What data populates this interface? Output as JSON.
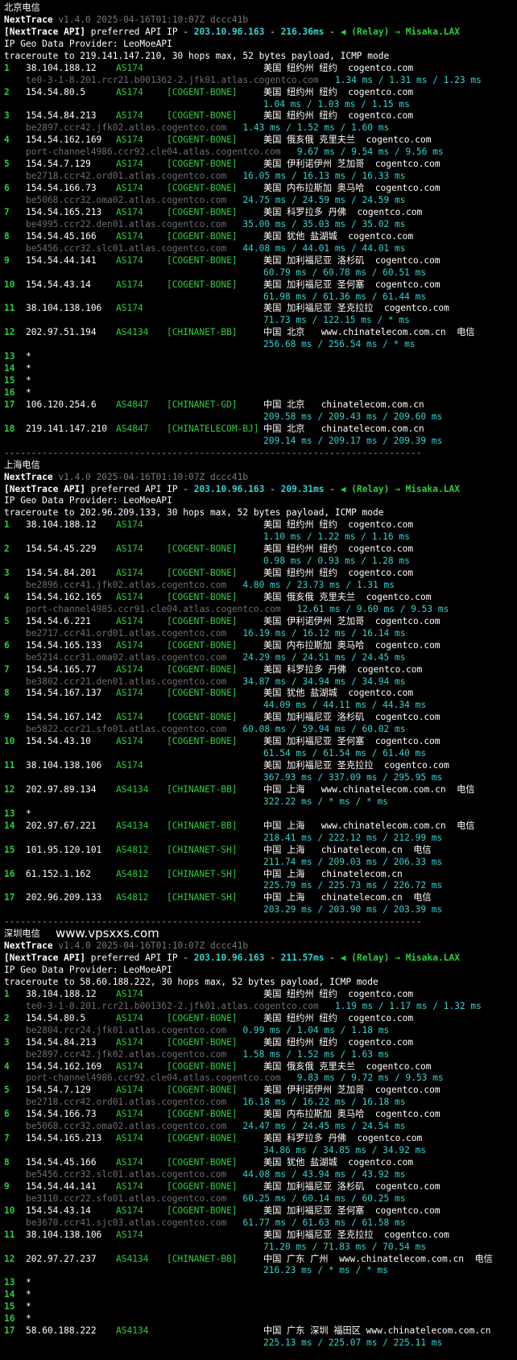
{
  "colors": {
    "background": "#000000",
    "asn": "#2ecc40",
    "rtt": "#3ad0d0",
    "hostname": "#6e6e6e"
  },
  "sections": [
    {
      "title": "北京电信",
      "version_name": "NextTrace",
      "version": "v1.4.0 2025-04-16T01:10:07Z dccc41b",
      "api_prefix": "[NextTrace API]",
      "api_text": "preferred API IP -",
      "api_ip": "203.10.96.163",
      "api_dash": "-",
      "api_latency": "216.36ms",
      "api_dash2": "-",
      "api_relay": "◀ (Relay) → Misaka.LAX",
      "geo_provider": "IP Geo Data Provider: LeoMoeAPI",
      "traceroute": "traceroute to 219.141.147.210, 30 hops max, 52 bytes payload, ICMP mode",
      "hops": [
        {
          "n": "1",
          "ip": "38.104.188.12",
          "asn": "AS174",
          "tag": "",
          "geo": "美国 纽约州 纽约  cogentco.com",
          "host": "te0-3-1-8.201.rcr21.b001362-2.jfk01.atlas.cogentco.com",
          "rtt": "1.34 ms / 1.31 ms / 1.23 ms"
        },
        {
          "n": "2",
          "ip": "154.54.80.5",
          "asn": "AS174",
          "tag": "[COGENT-BONE]",
          "geo": "美国 纽约州 纽约  cogentco.com",
          "host": "",
          "rtt": "1.04 ms / 1.03 ms / 1.15 ms"
        },
        {
          "n": "3",
          "ip": "154.54.84.213",
          "asn": "AS174",
          "tag": "[COGENT-BONE]",
          "geo": "美国 纽约州 纽约  cogentco.com",
          "host": "be2897.ccr42.jfk02.atlas.cogentco.com",
          "rtt": "1.43 ms / 1.52 ms / 1.60 ms"
        },
        {
          "n": "4",
          "ip": "154.54.162.169",
          "asn": "AS174",
          "tag": "[COGENT-BONE]",
          "geo": "美国 俄亥俄 克里夫兰  cogentco.com",
          "host": "port-channel4986.ccr92.cle04.atlas.cogentco.com",
          "rtt": "9.67 ms / 9.54 ms / 9.56 ms"
        },
        {
          "n": "5",
          "ip": "154.54.7.129",
          "asn": "AS174",
          "tag": "[COGENT-BONE]",
          "geo": "美国 伊利诺伊州 芝加哥  cogentco.com",
          "host": "be2718.ccr42.ord01.atlas.cogentco.com",
          "rtt": "16.05 ms / 16.13 ms / 16.33 ms"
        },
        {
          "n": "6",
          "ip": "154.54.166.73",
          "asn": "AS174",
          "tag": "[COGENT-BONE]",
          "geo": "美国 内布拉斯加 奥马哈  cogentco.com",
          "host": "be5068.ccr32.oma02.atlas.cogentco.com",
          "rtt": "24.75 ms / 24.59 ms / 24.59 ms"
        },
        {
          "n": "7",
          "ip": "154.54.165.213",
          "asn": "AS174",
          "tag": "[COGENT-BONE]",
          "geo": "美国 科罗拉多 丹佛  cogentco.com",
          "host": "be4995.ccr22.den01.atlas.cogentco.com",
          "rtt": "35.00 ms / 35.03 ms / 35.02 ms"
        },
        {
          "n": "8",
          "ip": "154.54.45.166",
          "asn": "AS174",
          "tag": "[COGENT-BONE]",
          "geo": "美国 犹他 盐湖城  cogentco.com",
          "host": "be5456.ccr32.slc01.atlas.cogentco.com",
          "rtt": "44.08 ms / 44.01 ms / 44.01 ms"
        },
        {
          "n": "9",
          "ip": "154.54.44.141",
          "asn": "AS174",
          "tag": "[COGENT-BONE]",
          "geo": "美国 加利福尼亚 洛杉矶  cogentco.com",
          "host": "",
          "rtt": "60.79 ms / 60.78 ms / 60.51 ms"
        },
        {
          "n": "10",
          "ip": "154.54.43.14",
          "asn": "AS174",
          "tag": "[COGENT-BONE]",
          "geo": "美国 加利福尼亚 圣何塞  cogentco.com",
          "host": "",
          "rtt": "61.98 ms / 61.36 ms / 61.44 ms"
        },
        {
          "n": "11",
          "ip": "38.104.138.106",
          "asn": "AS174",
          "tag": "",
          "geo": "美国 加利福尼亚 圣克拉拉  cogentco.com",
          "host": "",
          "rtt": "71.73 ms / 122.15 ms / * ms"
        },
        {
          "n": "12",
          "ip": "202.97.51.194",
          "asn": "AS4134",
          "tag": "[CHINANET-BB]",
          "geo": "中国 北京   www.chinatelecom.com.cn  电信",
          "host": "",
          "rtt": "256.68 ms / 256.54 ms / * ms"
        },
        {
          "n": "13",
          "ip": "*",
          "asn": "",
          "tag": "",
          "geo": "",
          "host": "",
          "rtt": "",
          "star": true
        },
        {
          "n": "14",
          "ip": "*",
          "asn": "",
          "tag": "",
          "geo": "",
          "host": "",
          "rtt": "",
          "star": true
        },
        {
          "n": "15",
          "ip": "*",
          "asn": "",
          "tag": "",
          "geo": "",
          "host": "",
          "rtt": "",
          "star": true
        },
        {
          "n": "16",
          "ip": "*",
          "asn": "",
          "tag": "",
          "geo": "",
          "host": "",
          "rtt": "",
          "star": true
        },
        {
          "n": "17",
          "ip": "106.120.254.6",
          "asn": "AS4847",
          "tag": "[CHINANET-GD]",
          "geo": "中国 北京   chinatelecom.com.cn",
          "host": "",
          "rtt": "209.58 ms / 209.43 ms / 209.60 ms"
        },
        {
          "n": "18",
          "ip": "219.141.147.210",
          "asn": "AS4847",
          "tag": "[CHINATELECOM-BJ]",
          "geo": "中国 北京   chinatelecom.com.cn",
          "host": "",
          "rtt": "209.14 ms / 209.17 ms / 209.39 ms"
        }
      ]
    },
    {
      "title": "上海电信",
      "version_name": "NextTrace",
      "version": "v1.4.0 2025-04-16T01:10:07Z dccc41b",
      "api_prefix": "[NextTrace API]",
      "api_text": "preferred API IP -",
      "api_ip": "203.10.96.163",
      "api_dash": "-",
      "api_latency": "209.31ms",
      "api_dash2": "-",
      "api_relay": "◀ (Relay) → Misaka.LAX",
      "geo_provider": "IP Geo Data Provider: LeoMoeAPI",
      "traceroute": "traceroute to 202.96.209.133, 30 hops max, 52 bytes payload, ICMP mode",
      "hops": [
        {
          "n": "1",
          "ip": "38.104.188.12",
          "asn": "AS174",
          "tag": "",
          "geo": "美国 纽约州 纽约  cogentco.com",
          "host": "",
          "rtt": "1.10 ms / 1.22 ms / 1.16 ms"
        },
        {
          "n": "2",
          "ip": "154.54.45.229",
          "asn": "AS174",
          "tag": "[COGENT-BONE]",
          "geo": "美国 纽约州 纽约  cogentco.com",
          "host": "",
          "rtt": "0.98 ms / 0.93 ms / 1.28 ms"
        },
        {
          "n": "3",
          "ip": "154.54.84.201",
          "asn": "AS174",
          "tag": "[COGENT-BONE]",
          "geo": "美国 纽约州 纽约  cogentco.com",
          "host": "be2896.ccr41.jfk02.atlas.cogentco.com",
          "rtt": "4.80 ms / 23.73 ms / 1.31 ms"
        },
        {
          "n": "4",
          "ip": "154.54.162.165",
          "asn": "AS174",
          "tag": "[COGENT-BONE]",
          "geo": "美国 俄亥俄 克里夫兰  cogentco.com",
          "host": "port-channel4985.ccr91.cle04.atlas.cogentco.com",
          "rtt": "12.61 ms / 9.60 ms / 9.53 ms"
        },
        {
          "n": "5",
          "ip": "154.54.6.221",
          "asn": "AS174",
          "tag": "[COGENT-BONE]",
          "geo": "美国 伊利诺伊州 芝加哥  cogentco.com",
          "host": "be2717.ccr41.ord01.atlas.cogentco.com",
          "rtt": "16.19 ms / 16.12 ms / 16.14 ms"
        },
        {
          "n": "6",
          "ip": "154.54.165.133",
          "asn": "AS174",
          "tag": "[COGENT-BONE]",
          "geo": "美国 内布拉斯加 奥马哈  cogentco.com",
          "host": "be5214.ccr31.oma02.atlas.cogentco.com",
          "rtt": "24.29 ms / 24.51 ms / 24.45 ms"
        },
        {
          "n": "7",
          "ip": "154.54.165.77",
          "asn": "AS174",
          "tag": "[COGENT-BONE]",
          "geo": "美国 科罗拉多 丹佛  cogentco.com",
          "host": "be3802.ccr21.den01.atlas.cogentco.com",
          "rtt": "34.87 ms / 34.94 ms / 34.94 ms"
        },
        {
          "n": "8",
          "ip": "154.54.167.137",
          "asn": "AS174",
          "tag": "[COGENT-BONE]",
          "geo": "美国 犹他 盐湖城  cogentco.com",
          "host": "",
          "rtt": "44.09 ms / 44.11 ms / 44.34 ms"
        },
        {
          "n": "9",
          "ip": "154.54.167.142",
          "asn": "AS174",
          "tag": "[COGENT-BONE]",
          "geo": "美国 加利福尼亚 洛杉矶  cogentco.com",
          "host": "be5822.ccr21.sfo01.atlas.cogentco.com",
          "rtt": "60.08 ms / 59.94 ms / 60.02 ms"
        },
        {
          "n": "10",
          "ip": "154.54.43.10",
          "asn": "AS174",
          "tag": "[COGENT-BONE]",
          "geo": "美国 加利福尼亚 圣何塞  cogentco.com",
          "host": "",
          "rtt": "61.54 ms / 61.54 ms / 61.40 ms"
        },
        {
          "n": "11",
          "ip": "38.104.138.106",
          "asn": "AS174",
          "tag": "",
          "geo": "美国 加利福尼亚 圣克拉拉  cogentco.com",
          "host": "",
          "rtt": "367.93 ms / 337.09 ms / 295.95 ms"
        },
        {
          "n": "12",
          "ip": "202.97.89.134",
          "asn": "AS4134",
          "tag": "[CHINANET-BB]",
          "geo": "中国 上海   www.chinatelecom.com.cn  电信",
          "host": "",
          "rtt": "322.22 ms / * ms / * ms"
        },
        {
          "n": "13",
          "ip": "*",
          "asn": "",
          "tag": "",
          "geo": "",
          "host": "",
          "rtt": "",
          "star": true
        },
        {
          "n": "14",
          "ip": "202.97.67.221",
          "asn": "AS4134",
          "tag": "[CHINANET-BB]",
          "geo": "中国 上海   www.chinatelecom.com.cn  电信",
          "host": "",
          "rtt": "218.41 ms / 222.12 ms / 212.99 ms"
        },
        {
          "n": "15",
          "ip": "101.95.120.101",
          "asn": "AS4812",
          "tag": "[CHINANET-SH]",
          "geo": "中国 上海   chinatelecom.cn  电信",
          "host": "",
          "rtt": "211.74 ms / 209.03 ms / 206.33 ms"
        },
        {
          "n": "16",
          "ip": "61.152.1.162",
          "asn": "AS4812",
          "tag": "[CHINANET-SH]",
          "geo": "中国 上海   chinatelecom.cn",
          "host": "",
          "rtt": "225.79 ms / 225.73 ms / 226.72 ms"
        },
        {
          "n": "17",
          "ip": "202.96.209.133",
          "asn": "AS4812",
          "tag": "[CHINANET-SH]",
          "geo": "中国 上海   chinatelecom.cn  电信",
          "host": "",
          "rtt": "203.29 ms / 203.90 ms / 203.39 ms"
        }
      ]
    },
    {
      "title": "深圳电信",
      "site": "www.vpsxxs.com",
      "version_name": "NextTrace",
      "version": "v1.4.0 2025-04-16T01:10:07Z dccc41b",
      "api_prefix": "[NextTrace API]",
      "api_text": "preferred API IP -",
      "api_ip": "203.10.96.163",
      "api_dash": "-",
      "api_latency": "211.57ms",
      "api_dash2": "-",
      "api_relay": "◀ (Relay) → Misaka.LAX",
      "geo_provider": "IP Geo Data Provider: LeoMoeAPI",
      "traceroute": "traceroute to 58.60.188.222, 30 hops max, 52 bytes payload, ICMP mode",
      "hops": [
        {
          "n": "1",
          "ip": "38.104.188.12",
          "asn": "AS174",
          "tag": "",
          "geo": "美国 纽约州 纽约  cogentco.com",
          "host": "te0-3-1-8.201.rcr21.b001362-2.jfk01.atlas.cogentco.com",
          "rtt": "1.19 ms / 1.17 ms / 1.32 ms"
        },
        {
          "n": "2",
          "ip": "154.54.80.5",
          "asn": "AS174",
          "tag": "[COGENT-BONE]",
          "geo": "美国 纽约州 纽约  cogentco.com",
          "host": "be2804.rcr24.jfk01.atlas.cogentco.com",
          "rtt": "0.99 ms / 1.04 ms / 1.18 ms"
        },
        {
          "n": "3",
          "ip": "154.54.84.213",
          "asn": "AS174",
          "tag": "[COGENT-BONE]",
          "geo": "美国 纽约州 纽约  cogentco.com",
          "host": "be2897.ccr42.jfk02.atlas.cogentco.com",
          "rtt": "1.58 ms / 1.52 ms / 1.63 ms"
        },
        {
          "n": "4",
          "ip": "154.54.162.169",
          "asn": "AS174",
          "tag": "[COGENT-BONE]",
          "geo": "美国 俄亥俄 克里夫兰  cogentco.com",
          "host": "port-channel4986.ccr92.cle04.atlas.cogentco.com",
          "rtt": "9.83 ms / 9.72 ms / 9.53 ms"
        },
        {
          "n": "5",
          "ip": "154.54.7.129",
          "asn": "AS174",
          "tag": "[COGENT-BONE]",
          "geo": "美国 伊利诺伊州 芝加哥  cogentco.com",
          "host": "be2718.ccr42.ord01.atlas.cogentco.com",
          "rtt": "16.18 ms / 16.22 ms / 16.18 ms"
        },
        {
          "n": "6",
          "ip": "154.54.166.73",
          "asn": "AS174",
          "tag": "[COGENT-BONE]",
          "geo": "美国 内布拉斯加 奥马哈  cogentco.com",
          "host": "be5068.ccr32.oma02.atlas.cogentco.com",
          "rtt": "24.47 ms / 24.45 ms / 24.54 ms"
        },
        {
          "n": "7",
          "ip": "154.54.165.213",
          "asn": "AS174",
          "tag": "[COGENT-BONE]",
          "geo": "美国 科罗拉多 丹佛  cogentco.com",
          "host": "",
          "rtt": "34.86 ms / 34.85 ms / 34.92 ms"
        },
        {
          "n": "8",
          "ip": "154.54.45.166",
          "asn": "AS174",
          "tag": "[COGENT-BONE]",
          "geo": "美国 犹他 盐湖城  cogentco.com",
          "host": "be5456.ccr32.slc01.atlas.cogentco.com",
          "rtt": "44.08 ms / 43.94 ms / 43.92 ms"
        },
        {
          "n": "9",
          "ip": "154.54.44.141",
          "asn": "AS174",
          "tag": "[COGENT-BONE]",
          "geo": "美国 加利福尼亚 洛杉矶  cogentco.com",
          "host": "be3110.ccr22.sfo01.atlas.cogentco.com",
          "rtt": "60.25 ms / 60.14 ms / 60.25 ms"
        },
        {
          "n": "10",
          "ip": "154.54.43.14",
          "asn": "AS174",
          "tag": "[COGENT-BONE]",
          "geo": "美国 加利福尼亚 圣何塞  cogentco.com",
          "host": "be3670.ccr41.sjc03.atlas.cogentco.com",
          "rtt": "61.77 ms / 61.63 ms / 61.58 ms"
        },
        {
          "n": "11",
          "ip": "38.104.138.106",
          "asn": "AS174",
          "tag": "",
          "geo": "美国 加利福尼亚 圣克拉拉  cogentco.com",
          "host": "",
          "rtt": "71.20 ms / 71.83 ms / 70.54 ms"
        },
        {
          "n": "12",
          "ip": "202.97.27.237",
          "asn": "AS4134",
          "tag": "[CHINANET-BB]",
          "geo": "中国 广东 广州  www.chinatelecom.com.cn  电信",
          "host": "",
          "rtt": "216.23 ms / * ms / * ms"
        },
        {
          "n": "13",
          "ip": "*",
          "asn": "",
          "tag": "",
          "geo": "",
          "host": "",
          "rtt": "",
          "star": true
        },
        {
          "n": "14",
          "ip": "*",
          "asn": "",
          "tag": "",
          "geo": "",
          "host": "",
          "rtt": "",
          "star": true
        },
        {
          "n": "15",
          "ip": "*",
          "asn": "",
          "tag": "",
          "geo": "",
          "host": "",
          "rtt": "",
          "star": true
        },
        {
          "n": "16",
          "ip": "*",
          "asn": "",
          "tag": "",
          "geo": "",
          "host": "",
          "rtt": "",
          "star": true
        },
        {
          "n": "17",
          "ip": "58.60.188.222",
          "asn": "AS4134",
          "tag": "",
          "geo": "中国 广东 深圳 福田区 www.chinatelecom.com.cn",
          "host": "",
          "rtt": "225.13 ms / 225.07 ms / 225.11 ms"
        }
      ]
    }
  ],
  "separator": "-----------------------------------------------------------------------------"
}
